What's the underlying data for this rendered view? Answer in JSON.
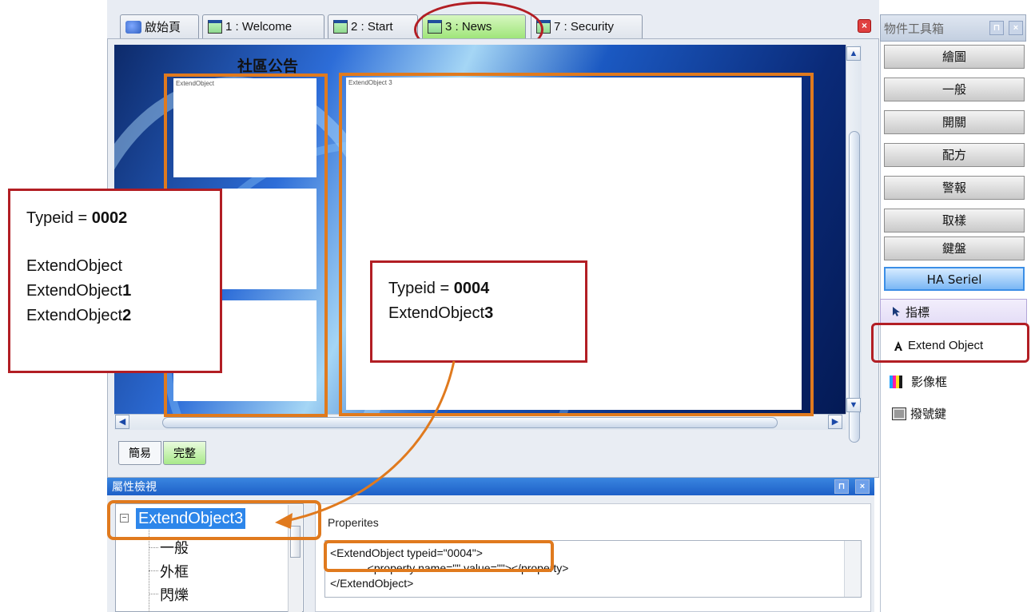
{
  "tabs": [
    {
      "label": "啟始頁",
      "kind": "home"
    },
    {
      "label": "1 : Welcome",
      "kind": "doc"
    },
    {
      "label": "2 : Start",
      "kind": "doc"
    },
    {
      "label": "3 : News",
      "kind": "doc",
      "active": true
    },
    {
      "label": "7 : Security",
      "kind": "doc"
    }
  ],
  "close_glyph": "×",
  "design": {
    "title": "社區公告",
    "placeholders": [
      "ExtendObject",
      "ExtendObject 3"
    ]
  },
  "bottom_tabs": [
    "簡易",
    "完整"
  ],
  "property_panel": {
    "title": "屬性檢視",
    "pin_glyph": "📌",
    "close_glyph": "×",
    "tree": {
      "toggle": "⊟",
      "selected": "ExtendObject3",
      "children": [
        "一般",
        "外框",
        "閃爍"
      ]
    },
    "props_label": "Properites",
    "xml_lines": [
      "<ExtendObject typeid=\"0004\">",
      "            <property name=\"\" value=\"\"></property>",
      "</ExtendObject>"
    ]
  },
  "toolbox": {
    "title": "物件工具箱",
    "groups": [
      "繪圖",
      "一般",
      "開關",
      "配方",
      "警報",
      "取樣",
      "鍵盤",
      "HA Seriel"
    ],
    "selected_group": "HA Seriel",
    "items": [
      {
        "label": "指標",
        "icon": "pointer-icon"
      },
      {
        "label": "Extend Object",
        "icon": "extend-object-icon"
      },
      {
        "label": "影像框",
        "icon": "image-frame-icon"
      },
      {
        "label": "撥號鍵",
        "icon": "dial-key-icon"
      }
    ]
  },
  "annotations": {
    "left_box": {
      "typeid_prefix": "Typeid = ",
      "typeid_value": "0002",
      "lines": [
        {
          "base": "ExtendObject",
          "suffix": ""
        },
        {
          "base": "ExtendObject",
          "suffix": "1"
        },
        {
          "base": "ExtendObject",
          "suffix": "2"
        }
      ]
    },
    "right_box": {
      "typeid_prefix": "Typeid = ",
      "typeid_value": "0004",
      "line": {
        "base": "ExtendObject",
        "suffix": "3"
      }
    },
    "colors": {
      "orange": "#e07a1e",
      "red": "#b21e24"
    }
  }
}
